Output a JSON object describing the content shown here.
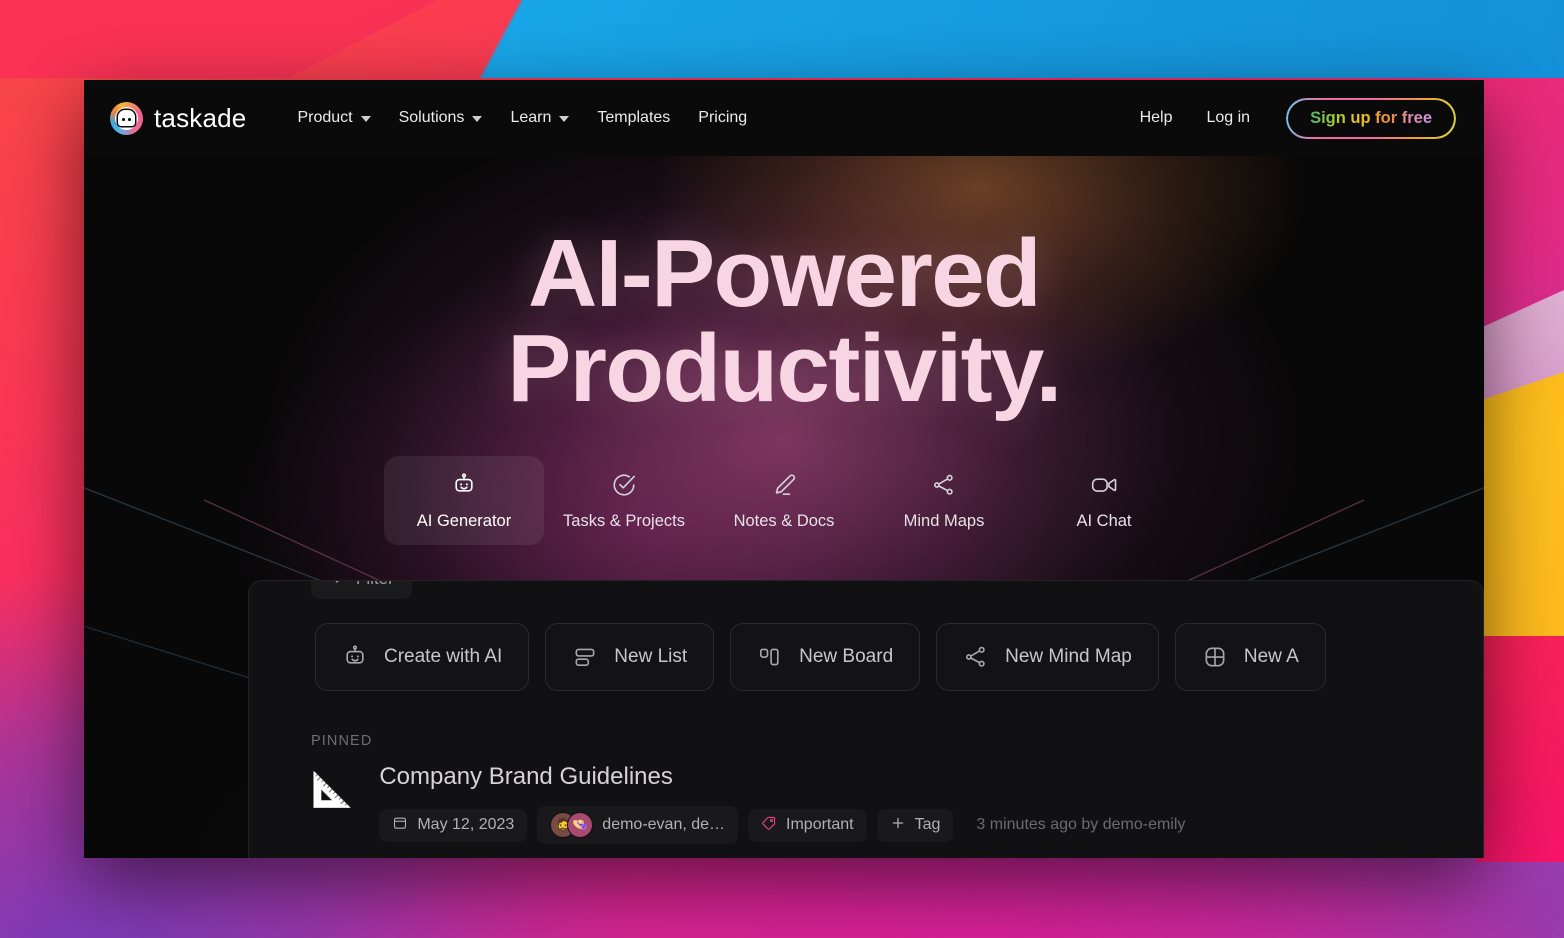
{
  "brand": {
    "name": "taskade",
    "logo_icon": "taskade-logo-icon"
  },
  "nav": {
    "links": [
      {
        "label": "Product",
        "has_caret": true
      },
      {
        "label": "Solutions",
        "has_caret": true
      },
      {
        "label": "Learn",
        "has_caret": true
      },
      {
        "label": "Templates",
        "has_caret": false
      },
      {
        "label": "Pricing",
        "has_caret": false
      }
    ],
    "help_label": "Help",
    "login_label": "Log in",
    "signup_label": "Sign up for free"
  },
  "hero": {
    "title_line1": "AI-Powered",
    "title_line2": "Productivity.",
    "title_color": "#f7d5e2"
  },
  "feature_tabs": [
    {
      "label": "AI Generator",
      "icon": "robot-icon",
      "active": true
    },
    {
      "label": "Tasks & Projects",
      "icon": "check-circle-icon",
      "active": false
    },
    {
      "label": "Notes & Docs",
      "icon": "pencil-icon",
      "active": false
    },
    {
      "label": "Mind Maps",
      "icon": "share-nodes-icon",
      "active": false
    },
    {
      "label": "AI Chat",
      "icon": "video-camera-icon",
      "active": false
    }
  ],
  "app_preview": {
    "filter_label": "Filter",
    "actions": [
      {
        "label": "Create with AI",
        "icon": "robot-icon"
      },
      {
        "label": "New List",
        "icon": "list-icon"
      },
      {
        "label": "New Board",
        "icon": "board-icon"
      },
      {
        "label": "New Mind Map",
        "icon": "share-nodes-icon"
      },
      {
        "label": "New A",
        "icon": "grid-icon"
      }
    ],
    "pinned_label": "PINNED",
    "pinned_item": {
      "emoji": "📐",
      "title": "Company Brand Guidelines",
      "date": "May 12, 2023",
      "date_icon": "calendar-icon",
      "collaborators": "demo-evan, de…",
      "tag_label": "Important",
      "tag_icon": "tag-icon",
      "add_tag_label": "Tag",
      "add_tag_icon": "plus-icon",
      "updated": "3 minutes ago by demo-emily"
    }
  },
  "colors": {
    "accent_pink": "#e8437f",
    "window_bg": "#080808",
    "card_bg": "#111114"
  }
}
